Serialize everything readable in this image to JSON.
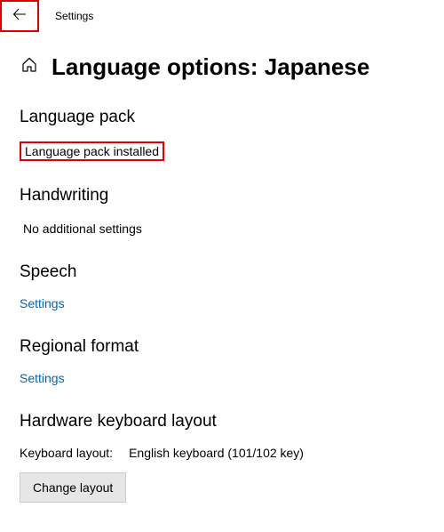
{
  "topbar": {
    "title": "Settings"
  },
  "header": {
    "page_title": "Language options: Japanese"
  },
  "sections": {
    "language_pack": {
      "heading": "Language pack",
      "status": "Language pack installed"
    },
    "handwriting": {
      "heading": "Handwriting",
      "status": "No additional settings"
    },
    "speech": {
      "heading": "Speech",
      "link": "Settings"
    },
    "regional_format": {
      "heading": "Regional format",
      "link": "Settings"
    },
    "hardware_keyboard": {
      "heading": "Hardware keyboard layout",
      "label": "Keyboard layout:",
      "value": "English keyboard (101/102 key)",
      "button": "Change layout"
    }
  }
}
